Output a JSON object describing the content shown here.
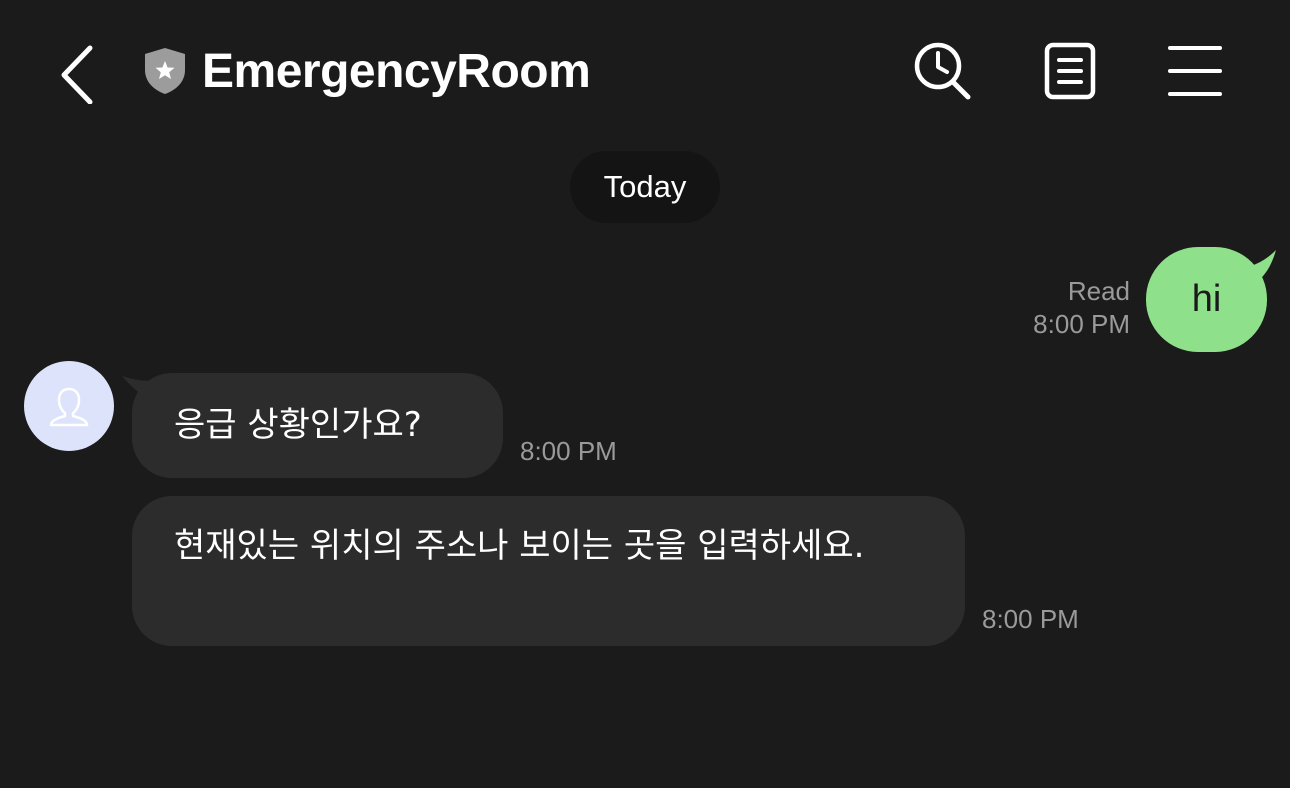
{
  "header": {
    "title": "EmergencyRoom",
    "back_icon": "chevron-left-icon",
    "verified_icon": "shield-star-icon",
    "actions": [
      "search-history-icon",
      "notes-icon",
      "menu-icon"
    ]
  },
  "date_divider": "Today",
  "messages": [
    {
      "direction": "outgoing",
      "text": "hi",
      "status": "Read",
      "time": "8:00 PM"
    },
    {
      "direction": "incoming",
      "text": "응급 상황인가요?",
      "time": "8:00 PM"
    },
    {
      "direction": "incoming",
      "text": "현재있는 위치의 주소나 보이는 곳을 입력하세요.",
      "time": "8:00 PM"
    }
  ],
  "colors": {
    "background": "#1b1b1b",
    "outgoing_bubble": "#8fe08a",
    "incoming_bubble": "#2c2c2c",
    "avatar_bg": "#dde3fb",
    "meta_text": "#9a9a9a"
  }
}
